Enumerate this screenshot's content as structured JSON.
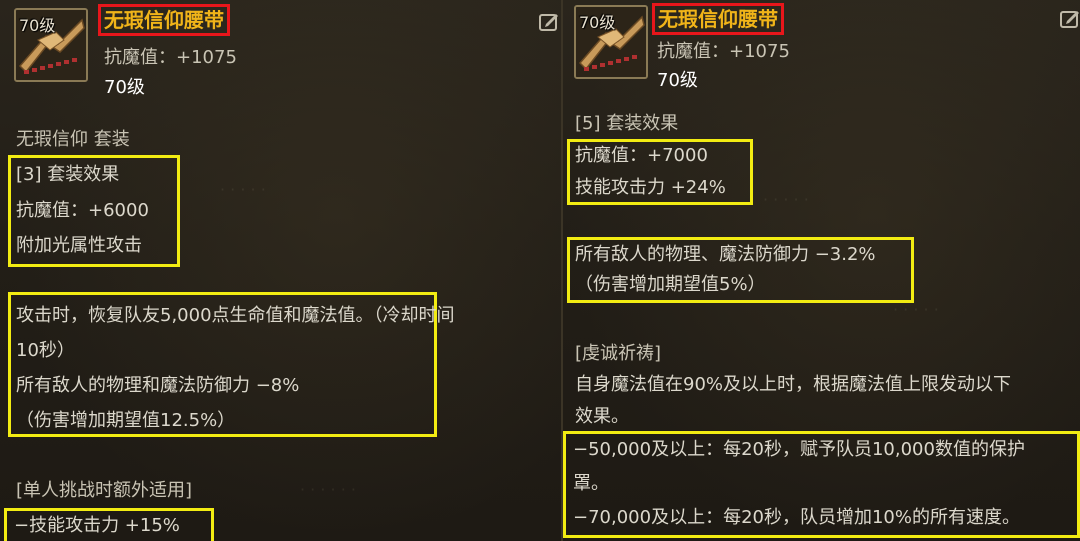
{
  "left": {
    "icon_level": "70级",
    "item_name": "无瑕信仰腰带",
    "magic_resist": "抗魔值：+1075",
    "level": "70级",
    "set_name": "无瑕信仰 套装",
    "set3_title": "[3] 套装效果",
    "set3_stat": "抗魔值：+6000",
    "set3_extra": "附加光属性攻击",
    "effect_line1": "攻击时，恢复队友5,000点生命值和魔法值。（冷却时间",
    "effect_line2": "10秒）",
    "effect_line3": "所有敌人的物理和魔法防御力 −8%",
    "effect_line4": "（伤害增加期望值12.5%）",
    "solo_title": "[单人挑战时额外适用]",
    "solo_effect": "−技能攻击力 +15%"
  },
  "right": {
    "icon_level": "70级",
    "item_name": "无瑕信仰腰带",
    "magic_resist": "抗魔值：+1075",
    "level": "70级",
    "set5_title": "[5] 套装效果",
    "set5_stat1": "抗魔值：+7000",
    "set5_stat2": "技能攻击力 +24%",
    "def_line1": "所有敌人的物理、魔法防御力 −3.2%",
    "def_line2": "（伤害增加期望值5%）",
    "prayer_title": "[虔诚祈祷]",
    "prayer_desc1": "自身魔法值在90%及以上时，根据魔法值上限发动以下",
    "prayer_desc2": "效果。",
    "tier1_line1": "−50,000及以上：每20秒，赋予队员10,000数值的保护",
    "tier1_line2": "罩。",
    "tier2_line1": "−70,000及以上：每20秒，队员增加10%的所有速度。"
  },
  "colors": {
    "item_name": "#f0b419",
    "name_box": "#e8161b",
    "highlight_box": "#f2ec12",
    "text": "#d8d4c8"
  },
  "icons": {
    "item": "belt-icon",
    "action": "edit-icon"
  }
}
